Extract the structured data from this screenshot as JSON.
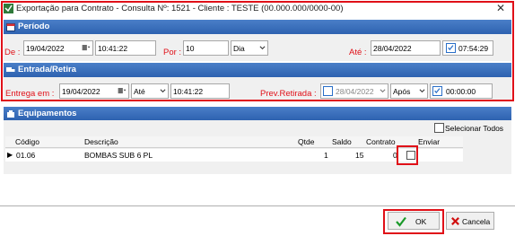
{
  "window": {
    "title": "Exportação para Contrato - Consulta Nº: 1521 - Cliente : TESTE (00.000.000/0000-00)",
    "close_glyph": "✕"
  },
  "periodo": {
    "header": "Período",
    "de_label": "De :",
    "de_date": "19/04/2022",
    "de_time": "10:41:22",
    "por_label": "Por :",
    "por_value": "10",
    "unit_value": "Dia",
    "ate_label": "Até :",
    "ate_date": "28/04/2022",
    "ate_time": "07:54:29",
    "ate_time_checked": true
  },
  "entrada": {
    "header": "Entrada/Retira",
    "entrega_label": "Entrega em :",
    "entrega_date": "19/04/2022",
    "entrega_mode": "Até",
    "entrega_time": "10:41:22",
    "prev_label": "Prev.Retirada :",
    "prev_date": "28/04/2022",
    "prev_mode": "Após",
    "prev_time": "00:00:00"
  },
  "equipamentos": {
    "header": "Equipamentos",
    "select_all_label": "Selecionar Todos",
    "columns": [
      "Código",
      "Descrição",
      "Qtde",
      "Saldo",
      "Contrato",
      "Enviar"
    ],
    "rows": [
      {
        "codigo": "01.06",
        "descricao": "BOMBAS SUB 6 PL",
        "qtde": "1",
        "saldo": "15",
        "contrato": "0"
      }
    ]
  },
  "footer": {
    "ok_label": "OK",
    "cancel_label": "Cancela"
  },
  "colors": {
    "highlight": "#e01018",
    "header_blue": "#2e62b0",
    "ok_green": "#1a9a2a",
    "cancel_red": "#d01010"
  }
}
